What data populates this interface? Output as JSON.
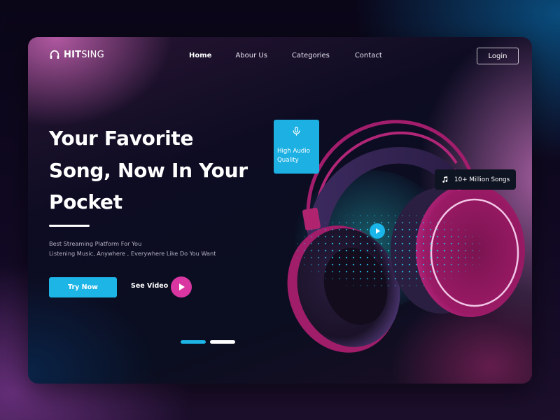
{
  "brand": {
    "logo_icon": "headphones-icon",
    "name_bold": "HIT",
    "name_regular": "SING"
  },
  "nav": {
    "items": [
      {
        "label": "Home",
        "active": true
      },
      {
        "label": "Abour Us",
        "active": false
      },
      {
        "label": "Categories",
        "active": false
      },
      {
        "label": "Contact",
        "active": false
      }
    ],
    "login_label": "Login"
  },
  "hero": {
    "title_lines": [
      "Your Favorite",
      "Song, Now In Your",
      "Pocket"
    ],
    "subtitle_lines": [
      "Best Streaming Platform For You",
      "Listening Music, Anywhere , Everywhere Like Do You Want"
    ],
    "try_now_label": "Try Now",
    "see_video_label": "See Video",
    "see_video_icon": "play-icon"
  },
  "badges": {
    "audio": {
      "icon": "microphone-icon",
      "lines": [
        "High Audio",
        "Quality"
      ]
    },
    "songs": {
      "icon": "music-note-icon",
      "label": "10+ Million Songs"
    }
  },
  "media": {
    "image": "headphones-photo",
    "play_icon": "play-icon"
  },
  "carousel": {
    "total": 2,
    "active_index": 0
  },
  "colors": {
    "accent_blue": "#1db4e6",
    "accent_pink": "#d936a2",
    "text_white": "#ffffff",
    "subtext": "#b7b3c4",
    "dot_inactive": "#ffffff"
  }
}
